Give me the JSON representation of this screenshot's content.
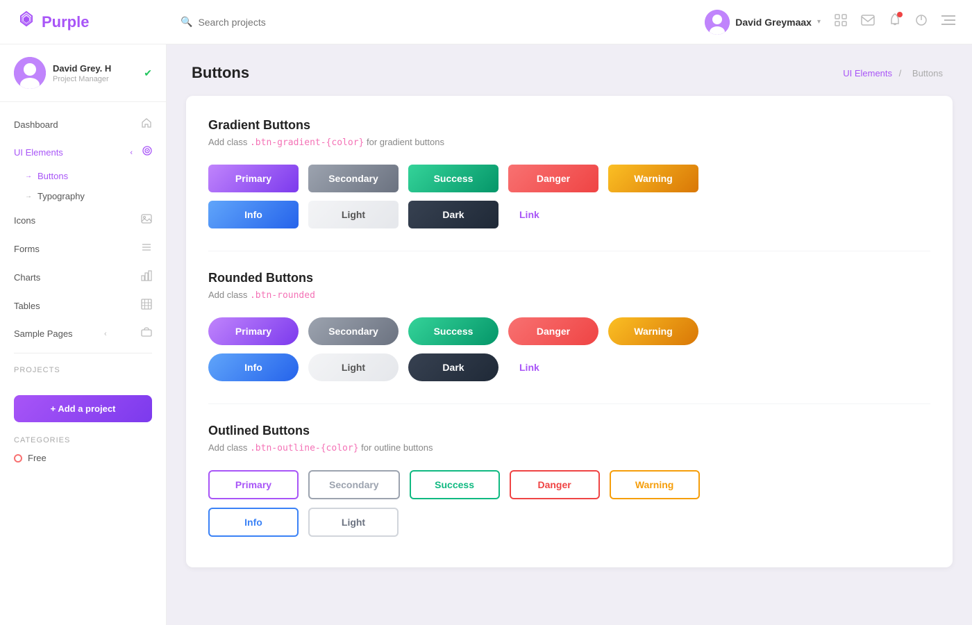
{
  "app": {
    "logo_text": "Purple",
    "logo_icon": "🔷"
  },
  "topnav": {
    "search_placeholder": "Search projects",
    "user_name": "David Greymaax",
    "user_chevron": "▾",
    "icons": {
      "expand": "⛶",
      "mail": "✉",
      "bell": "🔔",
      "power": "⏻",
      "menu": "☰"
    }
  },
  "sidebar": {
    "user_name": "David Grey. H",
    "user_role": "Project Manager",
    "nav_items": [
      {
        "label": "Dashboard",
        "icon": "🏠"
      },
      {
        "label": "UI Elements",
        "icon": "◎",
        "active": true
      },
      {
        "label": "Icons",
        "icon": "🖼"
      },
      {
        "label": "Forms",
        "icon": "☰"
      },
      {
        "label": "Charts",
        "icon": "📊"
      },
      {
        "label": "Tables",
        "icon": "⊞"
      },
      {
        "label": "Sample Pages",
        "icon": "📁"
      }
    ],
    "sub_items": [
      {
        "label": "Buttons",
        "active": true
      },
      {
        "label": "Typography",
        "active": false
      }
    ],
    "projects_label": "Projects",
    "add_project_label": "+ Add a project",
    "categories_label": "Categories",
    "free_label": "Free"
  },
  "page": {
    "title": "Buttons",
    "breadcrumb_parent": "UI Elements",
    "breadcrumb_current": "Buttons"
  },
  "sections": {
    "gradient": {
      "title": "Gradient Buttons",
      "desc_prefix": "Add class ",
      "desc_class": ".btn-gradient-{color}",
      "desc_suffix": " for gradient buttons",
      "buttons": [
        {
          "label": "Primary",
          "style": "primary"
        },
        {
          "label": "Secondary",
          "style": "secondary"
        },
        {
          "label": "Success",
          "style": "success"
        },
        {
          "label": "Danger",
          "style": "danger"
        },
        {
          "label": "Warning",
          "style": "warning"
        }
      ],
      "buttons2": [
        {
          "label": "Info",
          "style": "info"
        },
        {
          "label": "Light",
          "style": "light"
        },
        {
          "label": "Dark",
          "style": "dark"
        },
        {
          "label": "Link",
          "style": "link"
        }
      ]
    },
    "rounded": {
      "title": "Rounded Buttons",
      "desc_prefix": "Add class ",
      "desc_class": ".btn-rounded",
      "desc_suffix": "",
      "buttons": [
        {
          "label": "Primary",
          "style": "primary"
        },
        {
          "label": "Secondary",
          "style": "secondary"
        },
        {
          "label": "Success",
          "style": "success"
        },
        {
          "label": "Danger",
          "style": "danger"
        },
        {
          "label": "Warning",
          "style": "warning"
        }
      ],
      "buttons2": [
        {
          "label": "Info",
          "style": "info"
        },
        {
          "label": "Light",
          "style": "light"
        },
        {
          "label": "Dark",
          "style": "dark"
        },
        {
          "label": "Link",
          "style": "link"
        }
      ]
    },
    "outlined": {
      "title": "Outlined Buttons",
      "desc_prefix": "Add class ",
      "desc_class": ".btn-outline-{color}",
      "desc_suffix": " for outline buttons",
      "buttons": [
        {
          "label": "Primary",
          "style": "primary"
        },
        {
          "label": "Secondary",
          "style": "secondary"
        },
        {
          "label": "Success",
          "style": "success"
        },
        {
          "label": "Danger",
          "style": "danger"
        },
        {
          "label": "Warning",
          "style": "warning"
        }
      ]
    }
  }
}
